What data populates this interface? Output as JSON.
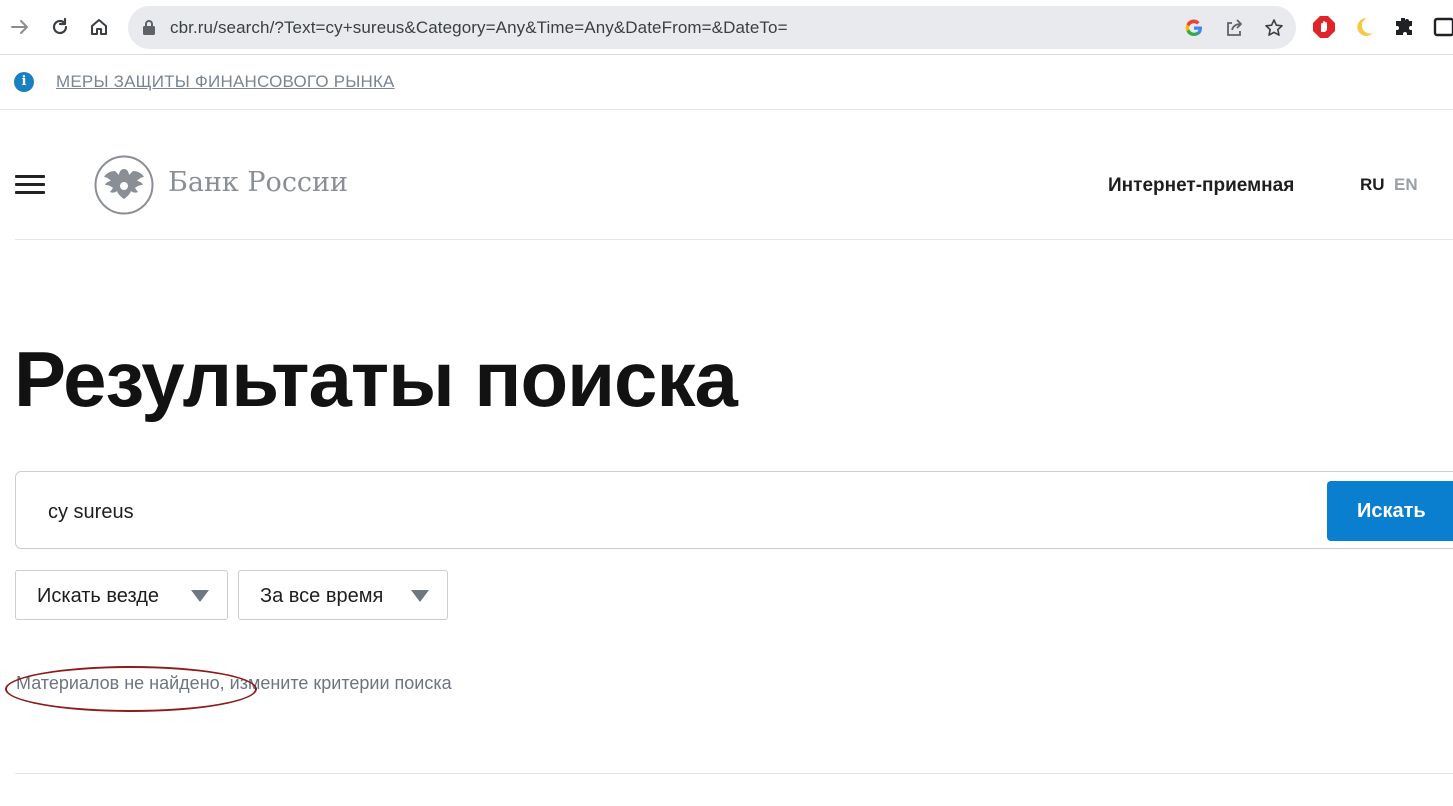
{
  "browser": {
    "url": "cbr.ru/search/?Text=cy+sureus&Category=Any&Time=Any&DateFrom=&DateTo=",
    "icons": [
      "forward-icon",
      "reload-icon",
      "home-icon",
      "lock-icon",
      "google-icon",
      "share-icon",
      "star-icon",
      "adblock-icon",
      "moon-icon",
      "extensions-icon",
      "sidepanel-icon"
    ]
  },
  "infobar": {
    "link": "МЕРЫ ЗАЩИТЫ ФИНАНСОВОГО РЫНКА"
  },
  "header": {
    "logo_text": "Банк России",
    "reception": "Интернет-приемная",
    "lang_ru": "RU",
    "lang_en": "EN"
  },
  "main": {
    "title": "Результаты поиска",
    "search_value": "cy sureus",
    "search_button": "Искать",
    "category_select": "Искать везде",
    "time_select": "За все время",
    "no_results": "Материалов не найдено, измените критерии поиска"
  },
  "colors": {
    "accent": "#0a7ecf",
    "info": "#1a7fc1",
    "annotation": "#8e1b1b"
  }
}
